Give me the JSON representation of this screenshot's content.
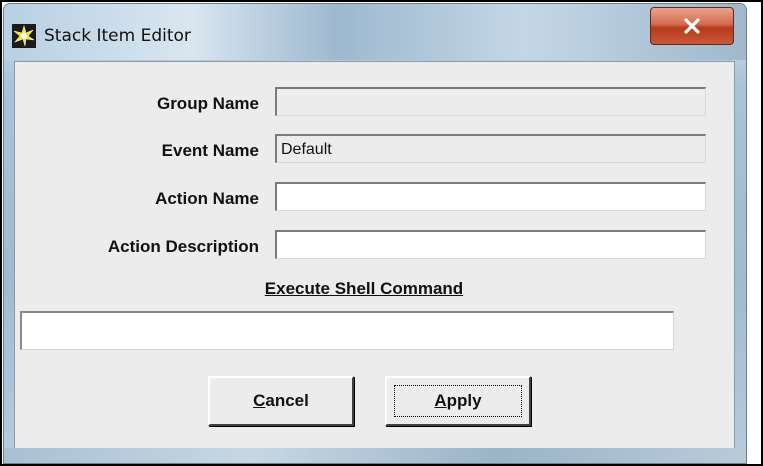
{
  "window": {
    "title": "Stack Item Editor",
    "icon": "starburst-icon",
    "close_icon": "close-icon"
  },
  "form": {
    "group_name": {
      "label": "Group Name",
      "value": ""
    },
    "event_name": {
      "label": "Event Name",
      "value": "Default"
    },
    "action_name": {
      "label": "Action Name",
      "value": ""
    },
    "action_description": {
      "label": "Action Description",
      "value": ""
    }
  },
  "shell_command": {
    "heading": "Execute Shell Command",
    "value": ""
  },
  "buttons": {
    "cancel": {
      "mnemonic": "C",
      "rest": "ancel"
    },
    "apply": {
      "mnemonic": "A",
      "rest": "pply"
    }
  },
  "colors": {
    "close_button": "#c9583a",
    "dialog_background": "#ececec"
  }
}
